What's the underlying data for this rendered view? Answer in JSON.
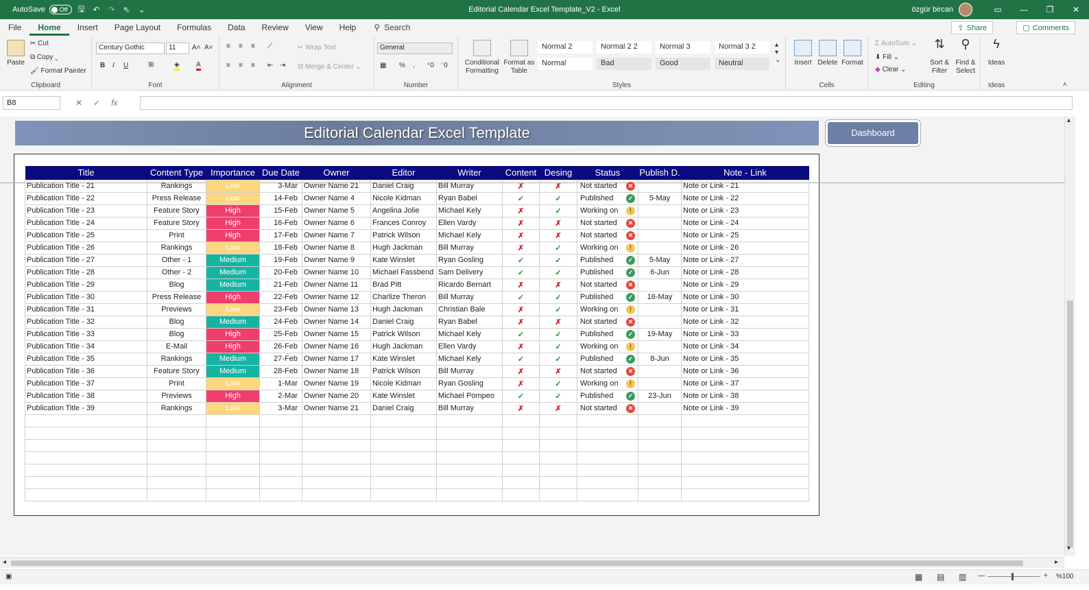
{
  "titlebar": {
    "autosave_label": "AutoSave",
    "autosave_state": "Off",
    "window_title": "Editorial Calendar Excel Template_V2  -  Excel",
    "user_name": "özgür bircan"
  },
  "menu": {
    "items": [
      "File",
      "Home",
      "Insert",
      "Page Layout",
      "Formulas",
      "Data",
      "Review",
      "View",
      "Help"
    ],
    "search": "Search",
    "share": "Share",
    "comments": "Comments"
  },
  "ribbon": {
    "clipboard": {
      "paste": "Paste",
      "cut": "Cut",
      "copy": "Copy",
      "format_painter": "Format Painter",
      "label": "Clipboard"
    },
    "font": {
      "name": "Century Gothic",
      "size": "11",
      "label": "Font"
    },
    "alignment": {
      "wrap": "Wrap Text",
      "merge": "Merge & Center",
      "label": "Alignment"
    },
    "number": {
      "format": "General",
      "label": "Number"
    },
    "styles": {
      "conditional": "Conditional Formatting",
      "format_as_table": "Format as Table",
      "cells": [
        "Normal 2",
        "Normal 2 2",
        "Normal 3",
        "Normal 3 2",
        "Normal",
        "Bad",
        "Good",
        "Neutral"
      ],
      "label": "Styles"
    },
    "cells": {
      "insert": "Insert",
      "delete": "Delete",
      "format": "Format",
      "label": "Cells"
    },
    "editing": {
      "autosum": "AutoSum",
      "fill": "Fill",
      "clear": "Clear",
      "sort": "Sort & Filter",
      "find": "Find & Select",
      "label": "Editing"
    },
    "ideas": {
      "ideas": "Ideas",
      "label": "Ideas"
    }
  },
  "formula_bar": {
    "name_box": "B8",
    "fx": "fx",
    "formula": ""
  },
  "sheet": {
    "banner_title": "Editorial Calendar Excel Template",
    "dashboard_button": "Dashboard",
    "headers": [
      "Title",
      "Content Type",
      "Importance",
      "Due Date",
      "Owner",
      "Editor",
      "Writer",
      "Content",
      "Desing",
      "Status",
      "Publish D.",
      "Note - Link"
    ],
    "rows": [
      {
        "title": "Publication Title - 21",
        "type": "Rankings",
        "importance": "Low",
        "due": "3-Mar",
        "owner": "Owner Name 21",
        "editor": "Daniel Craig",
        "writer": "Bill Murray",
        "content": "x",
        "design": "x",
        "status": "Not started",
        "publish": "",
        "note": "Note or Link - 21"
      },
      {
        "title": "Publication Title - 22",
        "type": "Press Release",
        "importance": "Low",
        "due": "14-Feb",
        "owner": "Owner Name 4",
        "editor": "Nicole Kidman",
        "writer": "Ryan Babel",
        "content": "check",
        "design": "check",
        "status": "Published",
        "publish": "5-May",
        "note": "Note or Link - 22"
      },
      {
        "title": "Publication Title - 23",
        "type": "Feature Story",
        "importance": "High",
        "due": "15-Feb",
        "owner": "Owner Name 5",
        "editor": "Angelina Jolie",
        "writer": "Michael Kely",
        "content": "x",
        "design": "check",
        "status": "Working on",
        "publish": "",
        "note": "Note or Link - 23"
      },
      {
        "title": "Publication Title - 24",
        "type": "Feature Story",
        "importance": "High",
        "due": "16-Feb",
        "owner": "Owner Name 6",
        "editor": "Frances Conroy",
        "writer": "Ellen Vardy",
        "content": "x",
        "design": "x",
        "status": "Not started",
        "publish": "",
        "note": "Note or Link - 24"
      },
      {
        "title": "Publication Title - 25",
        "type": "Print",
        "importance": "High",
        "due": "17-Feb",
        "owner": "Owner Name 7",
        "editor": "Patrick Wilson",
        "writer": "Michael Kely",
        "content": "x",
        "design": "x",
        "status": "Not started",
        "publish": "",
        "note": "Note or Link - 25"
      },
      {
        "title": "Publication Title - 26",
        "type": "Rankings",
        "importance": "Low",
        "due": "18-Feb",
        "owner": "Owner Name 8",
        "editor": "Hugh Jackman",
        "writer": "Bill Murray",
        "content": "x",
        "design": "check",
        "status": "Working on",
        "publish": "",
        "note": "Note or Link - 26"
      },
      {
        "title": "Publication Title - 27",
        "type": "Other - 1",
        "importance": "Medium",
        "due": "19-Feb",
        "owner": "Owner Name 9",
        "editor": "Kate Winslet",
        "writer": "Ryan Gosling",
        "content": "check",
        "design": "check",
        "status": "Published",
        "publish": "5-May",
        "note": "Note or Link - 27"
      },
      {
        "title": "Publication Title - 28",
        "type": "Other - 2",
        "importance": "Medium",
        "due": "20-Feb",
        "owner": "Owner Name 10",
        "editor": "Michael Fassbend",
        "writer": "Sam Delivery",
        "content": "check",
        "design": "check",
        "status": "Published",
        "publish": "6-Jun",
        "note": "Note or Link - 28"
      },
      {
        "title": "Publication Title - 29",
        "type": "Blog",
        "importance": "Medium",
        "due": "21-Feb",
        "owner": "Owner Name 11",
        "editor": "Brad Pitt",
        "writer": "Ricardo Bernart",
        "content": "x",
        "design": "x",
        "status": "Not started",
        "publish": "",
        "note": "Note or Link - 29"
      },
      {
        "title": "Publication Title - 30",
        "type": "Press Release",
        "importance": "High",
        "due": "22-Feb",
        "owner": "Owner Name 12",
        "editor": "Charlize Theron",
        "writer": "Bill Murray",
        "content": "check",
        "design": "check",
        "status": "Published",
        "publish": "16-May",
        "note": "Note or Link - 30"
      },
      {
        "title": "Publication Title - 31",
        "type": "Previews",
        "importance": "Low",
        "due": "23-Feb",
        "owner": "Owner Name 13",
        "editor": "Hugh Jackman",
        "writer": "Christian Bale",
        "content": "x",
        "design": "check",
        "status": "Working on",
        "publish": "",
        "note": "Note or Link - 31"
      },
      {
        "title": "Publication Title - 32",
        "type": "Blog",
        "importance": "Medium",
        "due": "24-Feb",
        "owner": "Owner Name 14",
        "editor": "Daniel Craig",
        "writer": "Ryan Babel",
        "content": "x",
        "design": "x",
        "status": "Not started",
        "publish": "",
        "note": "Note or Link - 32"
      },
      {
        "title": "Publication Title - 33",
        "type": "Blog",
        "importance": "High",
        "due": "25-Feb",
        "owner": "Owner Name 15",
        "editor": "Patrick Wilson",
        "writer": "Michael Kely",
        "content": "check",
        "design": "check",
        "status": "Published",
        "publish": "19-May",
        "note": "Note or Link - 33"
      },
      {
        "title": "Publication Title - 34",
        "type": "E-Mail",
        "importance": "High",
        "due": "26-Feb",
        "owner": "Owner Name 16",
        "editor": "Hugh Jackman",
        "writer": "Ellen Vardy",
        "content": "x",
        "design": "check",
        "status": "Working on",
        "publish": "",
        "note": "Note or Link - 34"
      },
      {
        "title": "Publication Title - 35",
        "type": "Rankings",
        "importance": "Medium",
        "due": "27-Feb",
        "owner": "Owner Name 17",
        "editor": "Kate Winslet",
        "writer": "Michael Kely",
        "content": "check",
        "design": "check",
        "status": "Published",
        "publish": "8-Jun",
        "note": "Note or Link - 35"
      },
      {
        "title": "Publication Title - 36",
        "type": "Feature Story",
        "importance": "Medium",
        "due": "28-Feb",
        "owner": "Owner Name 18",
        "editor": "Patrick Wilson",
        "writer": "Bill Murray",
        "content": "x",
        "design": "x",
        "status": "Not started",
        "publish": "",
        "note": "Note or Link - 36"
      },
      {
        "title": "Publication Title - 37",
        "type": "Print",
        "importance": "Low",
        "due": "1-Mar",
        "owner": "Owner Name 19",
        "editor": "Nicole Kidman",
        "writer": "Ryan Gosling",
        "content": "x",
        "design": "check",
        "status": "Working on",
        "publish": "",
        "note": "Note or Link - 37"
      },
      {
        "title": "Publication Title - 38",
        "type": "Previews",
        "importance": "High",
        "due": "2-Mar",
        "owner": "Owner Name 20",
        "editor": "Kate Winslet",
        "writer": "Michael Pompeo",
        "content": "check",
        "design": "check",
        "status": "Published",
        "publish": "23-Jun",
        "note": "Note or Link - 38"
      },
      {
        "title": "Publication Title - 39",
        "type": "Rankings",
        "importance": "Low",
        "due": "3-Mar",
        "owner": "Owner Name 21",
        "editor": "Daniel Craig",
        "writer": "Bill Murray",
        "content": "x",
        "design": "x",
        "status": "Not started",
        "publish": "",
        "note": "Note or Link - 39"
      }
    ],
    "empty_rows": 7
  },
  "statusbar": {
    "zoom": "%100"
  },
  "colors": {
    "excel_green": "#217346",
    "header_navy": "#0b0b80",
    "low": "#fcd77f",
    "high": "#ef3e6c",
    "medium": "#16b3a3"
  }
}
